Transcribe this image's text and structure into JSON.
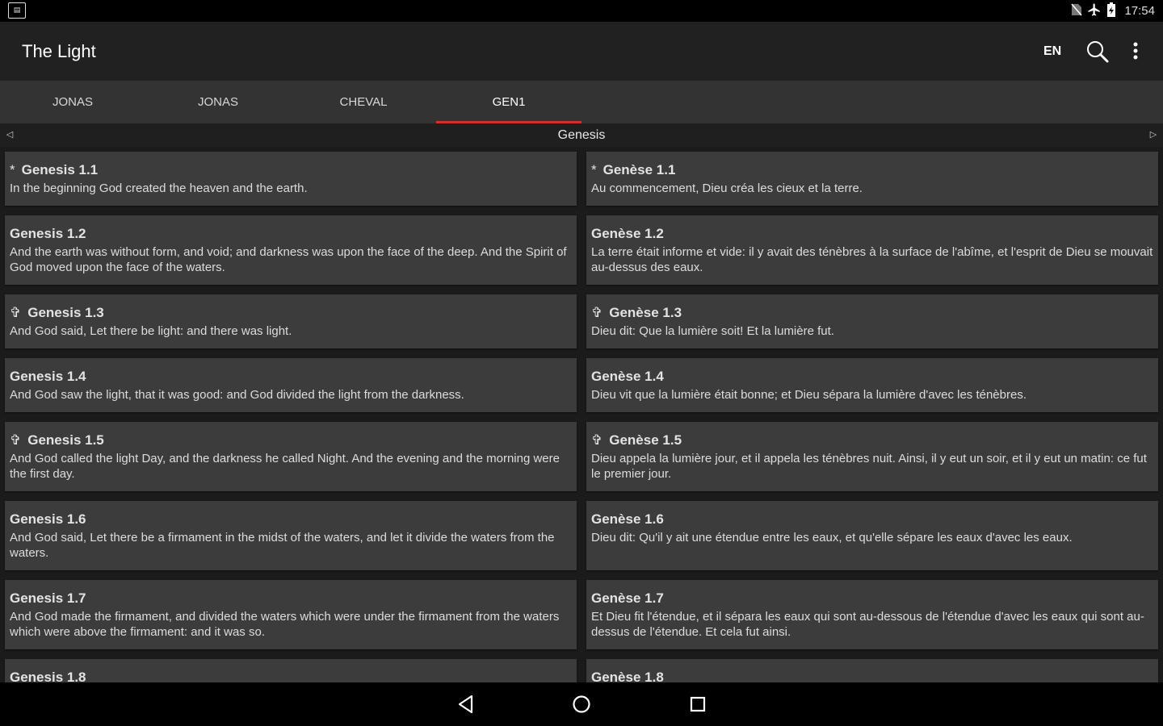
{
  "status_bar": {
    "notification_icon": "app-notification-icon",
    "icons": [
      "no-sim-icon",
      "airplane-mode-icon",
      "battery-charging-icon"
    ],
    "time": "17:54"
  },
  "toolbar": {
    "title": "The Light",
    "language": "EN",
    "search_icon": "search-icon",
    "menu_icon": "overflow-menu-icon"
  },
  "tabs": [
    {
      "label": "JONAS",
      "active": false
    },
    {
      "label": "JONAS",
      "active": false
    },
    {
      "label": "CHEVAL",
      "active": false
    },
    {
      "label": "GEN1",
      "active": true
    }
  ],
  "book_nav": {
    "prev_symbol": "◁",
    "book": "Genesis",
    "next_symbol": "▷"
  },
  "verses": [
    {
      "marker": "*",
      "left_ref": "Genesis 1.1",
      "left_text": "In the beginning God created the heaven and the earth.",
      "right_ref": "Genèse 1.1",
      "right_text": "Au commencement, Dieu créa les cieux et la terre."
    },
    {
      "marker": "",
      "left_ref": "Genesis 1.2",
      "left_text": "And the earth was without form, and void; and darkness was upon the face of the deep. And the Spirit of God moved upon the face of the waters.",
      "right_ref": "Genèse 1.2",
      "right_text": "La terre était informe et vide: il y avait des ténèbres à la surface de l'abîme, et l'esprit de Dieu se mouvait au-dessus des eaux."
    },
    {
      "marker": "✞",
      "left_ref": "Genesis 1.3",
      "left_text": "And God said, Let there be light: and there was light.",
      "right_ref": "Genèse 1.3",
      "right_text": "Dieu dit: Que la lumière soit! Et la lumière fut."
    },
    {
      "marker": "",
      "left_ref": "Genesis 1.4",
      "left_text": "And God saw the light, that it was good: and God divided the light from the darkness.",
      "right_ref": "Genèse 1.4",
      "right_text": "Dieu vit que la lumière était bonne; et Dieu sépara la lumière d'avec les ténèbres."
    },
    {
      "marker": "✞",
      "left_ref": "Genesis 1.5",
      "left_text": "And God called the light Day, and the darkness he called Night. And the evening and the morning were the first day.",
      "right_ref": "Genèse 1.5",
      "right_text": "Dieu appela la lumière jour, et il appela les ténèbres nuit. Ainsi, il y eut un soir, et il y eut un matin: ce fut le premier jour."
    },
    {
      "marker": "",
      "left_ref": "Genesis 1.6",
      "left_text": "And God said, Let there be a firmament in the midst of the waters, and let it divide the waters from the waters.",
      "right_ref": "Genèse 1.6",
      "right_text": "Dieu dit: Qu'il y ait une étendue entre les eaux, et qu'elle sépare les eaux d'avec les eaux."
    },
    {
      "marker": "",
      "left_ref": "Genesis 1.7",
      "left_text": "And God made the firmament, and divided the waters which were under the firmament from the waters which were above the firmament: and it was so.",
      "right_ref": "Genèse 1.7",
      "right_text": "Et Dieu fit l'étendue, et il sépara les eaux qui sont au-dessous de l'étendue d'avec les eaux qui sont au-dessus de l'étendue. Et cela fut ainsi."
    },
    {
      "marker": "",
      "left_ref": "Genesis 1.8",
      "left_text": "",
      "right_ref": "Genèse 1.8",
      "right_text": ""
    }
  ],
  "nav_bar": {
    "icons": [
      "back-icon",
      "home-icon",
      "recents-icon"
    ]
  }
}
